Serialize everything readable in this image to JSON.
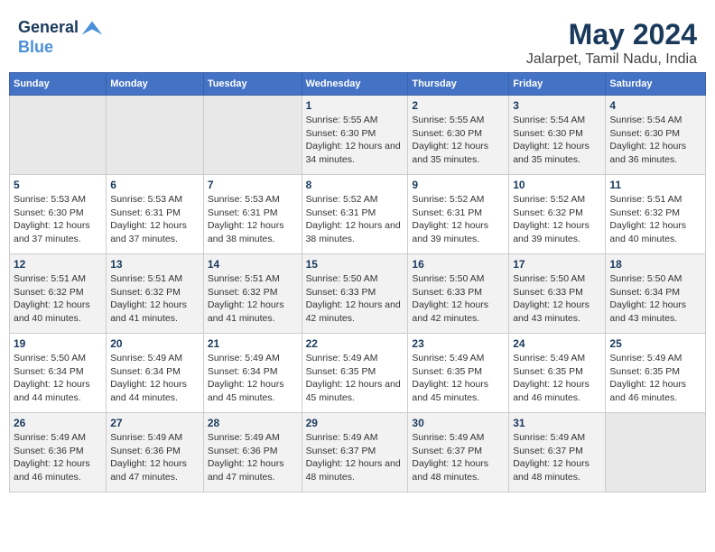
{
  "header": {
    "logo_line1": "General",
    "logo_line2": "Blue",
    "title": "May 2024",
    "subtitle": "Jalarpet, Tamil Nadu, India"
  },
  "calendar": {
    "days_of_week": [
      "Sunday",
      "Monday",
      "Tuesday",
      "Wednesday",
      "Thursday",
      "Friday",
      "Saturday"
    ],
    "weeks": [
      [
        {
          "day": "",
          "empty": true
        },
        {
          "day": "",
          "empty": true
        },
        {
          "day": "",
          "empty": true
        },
        {
          "day": "1",
          "sunrise": "5:55 AM",
          "sunset": "6:30 PM",
          "daylight": "12 hours and 34 minutes."
        },
        {
          "day": "2",
          "sunrise": "5:55 AM",
          "sunset": "6:30 PM",
          "daylight": "12 hours and 35 minutes."
        },
        {
          "day": "3",
          "sunrise": "5:54 AM",
          "sunset": "6:30 PM",
          "daylight": "12 hours and 35 minutes."
        },
        {
          "day": "4",
          "sunrise": "5:54 AM",
          "sunset": "6:30 PM",
          "daylight": "12 hours and 36 minutes."
        }
      ],
      [
        {
          "day": "5",
          "sunrise": "5:53 AM",
          "sunset": "6:30 PM",
          "daylight": "12 hours and 37 minutes."
        },
        {
          "day": "6",
          "sunrise": "5:53 AM",
          "sunset": "6:31 PM",
          "daylight": "12 hours and 37 minutes."
        },
        {
          "day": "7",
          "sunrise": "5:53 AM",
          "sunset": "6:31 PM",
          "daylight": "12 hours and 38 minutes."
        },
        {
          "day": "8",
          "sunrise": "5:52 AM",
          "sunset": "6:31 PM",
          "daylight": "12 hours and 38 minutes."
        },
        {
          "day": "9",
          "sunrise": "5:52 AM",
          "sunset": "6:31 PM",
          "daylight": "12 hours and 39 minutes."
        },
        {
          "day": "10",
          "sunrise": "5:52 AM",
          "sunset": "6:32 PM",
          "daylight": "12 hours and 39 minutes."
        },
        {
          "day": "11",
          "sunrise": "5:51 AM",
          "sunset": "6:32 PM",
          "daylight": "12 hours and 40 minutes."
        }
      ],
      [
        {
          "day": "12",
          "sunrise": "5:51 AM",
          "sunset": "6:32 PM",
          "daylight": "12 hours and 40 minutes."
        },
        {
          "day": "13",
          "sunrise": "5:51 AM",
          "sunset": "6:32 PM",
          "daylight": "12 hours and 41 minutes."
        },
        {
          "day": "14",
          "sunrise": "5:51 AM",
          "sunset": "6:32 PM",
          "daylight": "12 hours and 41 minutes."
        },
        {
          "day": "15",
          "sunrise": "5:50 AM",
          "sunset": "6:33 PM",
          "daylight": "12 hours and 42 minutes."
        },
        {
          "day": "16",
          "sunrise": "5:50 AM",
          "sunset": "6:33 PM",
          "daylight": "12 hours and 42 minutes."
        },
        {
          "day": "17",
          "sunrise": "5:50 AM",
          "sunset": "6:33 PM",
          "daylight": "12 hours and 43 minutes."
        },
        {
          "day": "18",
          "sunrise": "5:50 AM",
          "sunset": "6:34 PM",
          "daylight": "12 hours and 43 minutes."
        }
      ],
      [
        {
          "day": "19",
          "sunrise": "5:50 AM",
          "sunset": "6:34 PM",
          "daylight": "12 hours and 44 minutes."
        },
        {
          "day": "20",
          "sunrise": "5:49 AM",
          "sunset": "6:34 PM",
          "daylight": "12 hours and 44 minutes."
        },
        {
          "day": "21",
          "sunrise": "5:49 AM",
          "sunset": "6:34 PM",
          "daylight": "12 hours and 45 minutes."
        },
        {
          "day": "22",
          "sunrise": "5:49 AM",
          "sunset": "6:35 PM",
          "daylight": "12 hours and 45 minutes."
        },
        {
          "day": "23",
          "sunrise": "5:49 AM",
          "sunset": "6:35 PM",
          "daylight": "12 hours and 45 minutes."
        },
        {
          "day": "24",
          "sunrise": "5:49 AM",
          "sunset": "6:35 PM",
          "daylight": "12 hours and 46 minutes."
        },
        {
          "day": "25",
          "sunrise": "5:49 AM",
          "sunset": "6:35 PM",
          "daylight": "12 hours and 46 minutes."
        }
      ],
      [
        {
          "day": "26",
          "sunrise": "5:49 AM",
          "sunset": "6:36 PM",
          "daylight": "12 hours and 46 minutes."
        },
        {
          "day": "27",
          "sunrise": "5:49 AM",
          "sunset": "6:36 PM",
          "daylight": "12 hours and 47 minutes."
        },
        {
          "day": "28",
          "sunrise": "5:49 AM",
          "sunset": "6:36 PM",
          "daylight": "12 hours and 47 minutes."
        },
        {
          "day": "29",
          "sunrise": "5:49 AM",
          "sunset": "6:37 PM",
          "daylight": "12 hours and 48 minutes."
        },
        {
          "day": "30",
          "sunrise": "5:49 AM",
          "sunset": "6:37 PM",
          "daylight": "12 hours and 48 minutes."
        },
        {
          "day": "31",
          "sunrise": "5:49 AM",
          "sunset": "6:37 PM",
          "daylight": "12 hours and 48 minutes."
        },
        {
          "day": "",
          "empty": true
        }
      ]
    ]
  }
}
